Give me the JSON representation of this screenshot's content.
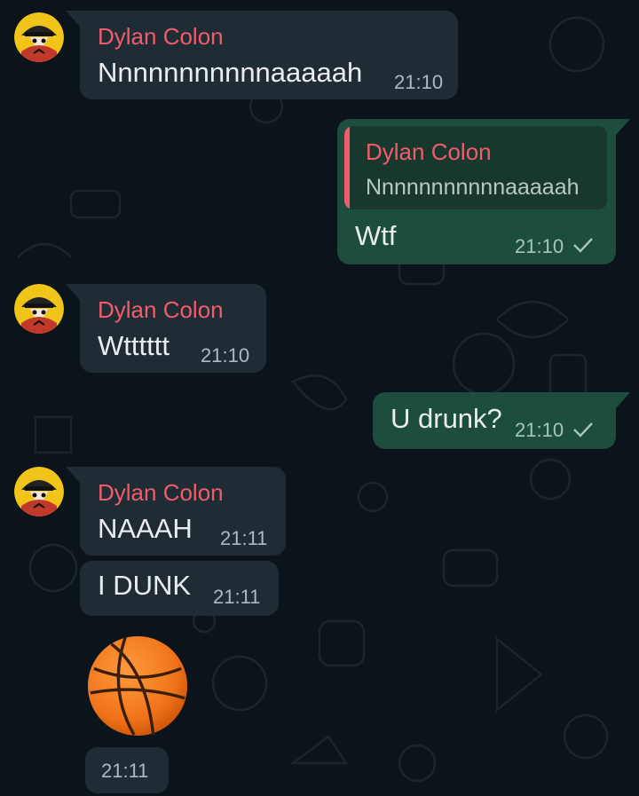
{
  "chat": {
    "messages": [
      {
        "sender": "Dylan Colon",
        "text": "Nnnnnnnnnnnaaaaah",
        "time": "21:10"
      },
      {
        "quote_sender": "Dylan Colon",
        "quote_text": "Nnnnnnnnnnnaaaaah",
        "text": "Wtf",
        "time": "21:10"
      },
      {
        "sender": "Dylan Colon",
        "text": "Wtttttt",
        "time": "21:10"
      },
      {
        "text": "U drunk?",
        "time": "21:10"
      },
      {
        "sender": "Dylan Colon",
        "text": "NAAAH",
        "time": "21:11"
      },
      {
        "text": "I DUNK",
        "time": "21:11"
      },
      {
        "sticker": "basketball-emoji",
        "time": "21:11"
      }
    ]
  },
  "colors": {
    "background": "#0b141a",
    "incoming_bubble": "#202c33",
    "outgoing_bubble": "#1d4d3c",
    "sender_name": "#f15c6d"
  },
  "icons": [
    "avatar",
    "single-check-icon",
    "basketball-emoji"
  ]
}
